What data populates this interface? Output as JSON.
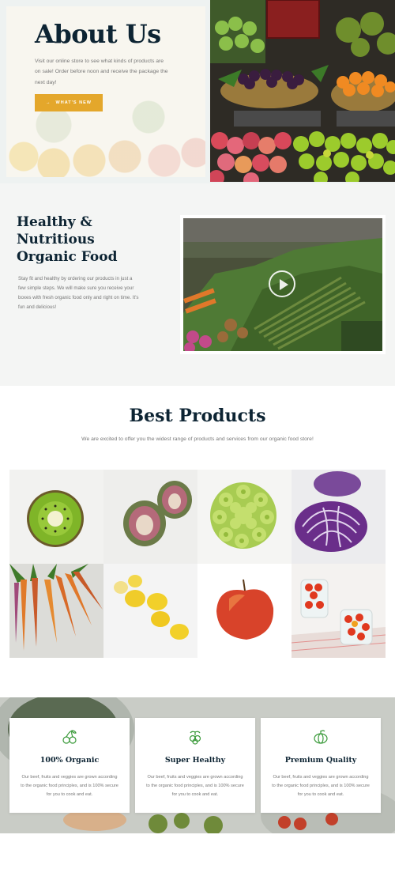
{
  "hero": {
    "title": "About Us",
    "text": "Visit our online store to see what kinds of products are on sale! Order before noon and receive the package the next day!",
    "button_label": "WHAT'S NEW",
    "button_icon": "arrow-right-icon",
    "accent_color": "#e4a72b"
  },
  "healthy": {
    "title": "Healthy & Nutritious Organic Food",
    "text": "Stay fit and healthy by ordering our products in just a few simple steps. We will make sure you receive your boxes with fresh organic food only and right on time. It's fun and delicious!",
    "video_icon": "play-icon"
  },
  "best": {
    "title": "Best Products",
    "subtitle": "We are excited to offer you the widest range of products and services from our organic food store!",
    "products": [
      "kiwi",
      "artichoke",
      "romanesco",
      "red-cabbage",
      "carrots",
      "lemons",
      "apple",
      "cherry-tomatoes"
    ]
  },
  "features": [
    {
      "icon": "cherries-icon",
      "title": "100% Organic",
      "text": "Our beef, fruits and veggies are grown according to the organic food principles, and is 100% secure for you to cook and eat."
    },
    {
      "icon": "berries-icon",
      "title": "Super Healthy",
      "text": "Our beef, fruits and veggies are grown according to the organic food principles, and is 100% secure for you to cook and eat."
    },
    {
      "icon": "pumpkin-icon",
      "title": "Premium Quality",
      "text": "Our beef, fruits and veggies are grown according to the organic food principles, and is 100% secure for you to cook and eat."
    }
  ],
  "colors": {
    "heading": "#0d2433",
    "body_text": "#777777",
    "accent": "#e4a72b",
    "icon_green": "#3a9a3a"
  }
}
